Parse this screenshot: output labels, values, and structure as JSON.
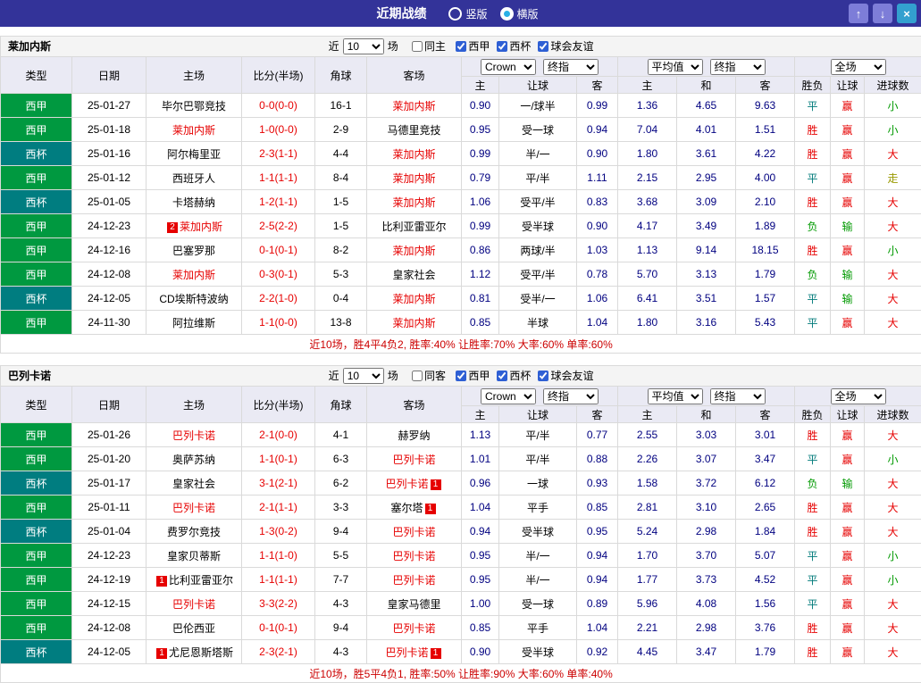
{
  "titlebar": {
    "title": "近期战绩",
    "radio_vertical": "竖版",
    "radio_horizontal": "横版",
    "selected": "横版"
  },
  "icons": {
    "up_arrow": "↑",
    "down_arrow": "↓",
    "close": "×"
  },
  "controls": {
    "near_label": "近",
    "count": "10",
    "games_label": "场",
    "leagues": [
      {
        "label": "西甲",
        "checked": true
      },
      {
        "label": "西杯",
        "checked": true
      },
      {
        "label": "球会友谊",
        "checked": true
      }
    ],
    "dd_group1": [
      "Crown",
      "终指"
    ],
    "dd_group2": [
      "平均值",
      "终指"
    ],
    "dd_group3": [
      "全场"
    ],
    "league_colors": {
      "西甲": "#009940",
      "西杯": "#007d80"
    },
    "result_colors": {
      "胜": "#e60000",
      "赢": "#e60000",
      "大": "#e60000",
      "平": "#007a7a",
      "负": "#009900",
      "输": "#009900",
      "小": "#009900",
      "走": "#999900"
    }
  },
  "columns": {
    "type": "类型",
    "date": "日期",
    "home": "主场",
    "score": "比分(半场)",
    "corner": "角球",
    "away": "客场",
    "ah": [
      "主",
      "让球",
      "客"
    ],
    "eu": [
      "主",
      "和",
      "客"
    ],
    "results": [
      "胜负",
      "让球",
      "进球数"
    ]
  },
  "sections": [
    {
      "team": "莱加内斯",
      "same_label": "同主",
      "rows": [
        {
          "lg": "西甲",
          "date": "25-01-27",
          "h": "毕尔巴鄂竞技",
          "a": "莱加内斯",
          "af": true,
          "score": "0-0(0-0)",
          "cor": "16-1",
          "o1": [
            "0.90",
            "一/球半",
            "0.99"
          ],
          "o2": [
            "1.36",
            "4.65",
            "9.63"
          ],
          "res": [
            "平",
            "赢",
            "小"
          ]
        },
        {
          "lg": "西甲",
          "date": "25-01-18",
          "h": "莱加内斯",
          "hf": true,
          "a": "马德里竞技",
          "score": "1-0(0-0)",
          "cor": "2-9",
          "o1": [
            "0.95",
            "受一球",
            "0.94"
          ],
          "o2": [
            "7.04",
            "4.01",
            "1.51"
          ],
          "res": [
            "胜",
            "赢",
            "小"
          ]
        },
        {
          "lg": "西杯",
          "date": "25-01-16",
          "h": "阿尔梅里亚",
          "a": "莱加内斯",
          "af": true,
          "score": "2-3(1-1)",
          "cor": "4-4",
          "o1": [
            "0.99",
            "半/一",
            "0.90"
          ],
          "o2": [
            "1.80",
            "3.61",
            "4.22"
          ],
          "res": [
            "胜",
            "赢",
            "大"
          ]
        },
        {
          "lg": "西甲",
          "date": "25-01-12",
          "h": "西班牙人",
          "a": "莱加内斯",
          "af": true,
          "score": "1-1(1-1)",
          "cor": "8-4",
          "o1": [
            "0.79",
            "平/半",
            "1.11"
          ],
          "o2": [
            "2.15",
            "2.95",
            "4.00"
          ],
          "res": [
            "平",
            "赢",
            "走"
          ]
        },
        {
          "lg": "西杯",
          "date": "25-01-05",
          "h": "卡塔赫纳",
          "a": "莱加内斯",
          "af": true,
          "score": "1-2(1-1)",
          "cor": "1-5",
          "o1": [
            "1.06",
            "受平/半",
            "0.83"
          ],
          "o2": [
            "3.68",
            "3.09",
            "2.10"
          ],
          "res": [
            "胜",
            "赢",
            "大"
          ]
        },
        {
          "lg": "西甲",
          "date": "24-12-23",
          "h": "莱加内斯",
          "hf": true,
          "hb_pre": "2",
          "a": "比利亚雷亚尔",
          "score": "2-5(2-2)",
          "cor": "1-5",
          "o1": [
            "0.99",
            "受半球",
            "0.90"
          ],
          "o2": [
            "4.17",
            "3.49",
            "1.89"
          ],
          "res": [
            "负",
            "输",
            "大"
          ]
        },
        {
          "lg": "西甲",
          "date": "24-12-16",
          "h": "巴塞罗那",
          "a": "莱加内斯",
          "af": true,
          "score": "0-1(0-1)",
          "cor": "8-2",
          "o1": [
            "0.86",
            "两球/半",
            "1.03"
          ],
          "o2": [
            "1.13",
            "9.14",
            "18.15"
          ],
          "res": [
            "胜",
            "赢",
            "小"
          ]
        },
        {
          "lg": "西甲",
          "date": "24-12-08",
          "h": "莱加内斯",
          "hf": true,
          "a": "皇家社会",
          "score": "0-3(0-1)",
          "cor": "5-3",
          "o1": [
            "1.12",
            "受平/半",
            "0.78"
          ],
          "o2": [
            "5.70",
            "3.13",
            "1.79"
          ],
          "res": [
            "负",
            "输",
            "大"
          ]
        },
        {
          "lg": "西杯",
          "date": "24-12-05",
          "h": "CD埃斯特波纳",
          "a": "莱加内斯",
          "af": true,
          "score": "2-2(1-0)",
          "cor": "0-4",
          "o1": [
            "0.81",
            "受半/一",
            "1.06"
          ],
          "o2": [
            "6.41",
            "3.51",
            "1.57"
          ],
          "res": [
            "平",
            "输",
            "大"
          ]
        },
        {
          "lg": "西甲",
          "date": "24-11-30",
          "h": "阿拉维斯",
          "a": "莱加内斯",
          "af": true,
          "score": "1-1(0-0)",
          "cor": "13-8",
          "o1": [
            "0.85",
            "半球",
            "1.04"
          ],
          "o2": [
            "1.80",
            "3.16",
            "5.43"
          ],
          "res": [
            "平",
            "赢",
            "大"
          ]
        }
      ],
      "summary": "近10场，胜4平4负2, 胜率:40% 让胜率:70% 大率:60% 单率:60%"
    },
    {
      "team": "巴列卡诺",
      "same_label": "同客",
      "rows": [
        {
          "lg": "西甲",
          "date": "25-01-26",
          "h": "巴列卡诺",
          "hf": true,
          "a": "赫罗纳",
          "score": "2-1(0-0)",
          "cor": "4-1",
          "o1": [
            "1.13",
            "平/半",
            "0.77"
          ],
          "o2": [
            "2.55",
            "3.03",
            "3.01"
          ],
          "res": [
            "胜",
            "赢",
            "大"
          ]
        },
        {
          "lg": "西甲",
          "date": "25-01-20",
          "h": "奥萨苏纳",
          "a": "巴列卡诺",
          "af": true,
          "score": "1-1(0-1)",
          "cor": "6-3",
          "o1": [
            "1.01",
            "平/半",
            "0.88"
          ],
          "o2": [
            "2.26",
            "3.07",
            "3.47"
          ],
          "res": [
            "平",
            "赢",
            "小"
          ]
        },
        {
          "lg": "西杯",
          "date": "25-01-17",
          "h": "皇家社会",
          "a": "巴列卡诺",
          "af": true,
          "ab_post": "1",
          "score": "3-1(2-1)",
          "cor": "6-2",
          "o1": [
            "0.96",
            "一球",
            "0.93"
          ],
          "o2": [
            "1.58",
            "3.72",
            "6.12"
          ],
          "res": [
            "负",
            "输",
            "大"
          ]
        },
        {
          "lg": "西甲",
          "date": "25-01-11",
          "h": "巴列卡诺",
          "hf": true,
          "a": "塞尔塔",
          "ab_post": "1",
          "score": "2-1(1-1)",
          "cor": "3-3",
          "o1": [
            "1.04",
            "平手",
            "0.85"
          ],
          "o2": [
            "2.81",
            "3.10",
            "2.65"
          ],
          "res": [
            "胜",
            "赢",
            "大"
          ]
        },
        {
          "lg": "西杯",
          "date": "25-01-04",
          "h": "费罗尔竞技",
          "a": "巴列卡诺",
          "af": true,
          "score": "1-3(0-2)",
          "cor": "9-4",
          "o1": [
            "0.94",
            "受半球",
            "0.95"
          ],
          "o2": [
            "5.24",
            "2.98",
            "1.84"
          ],
          "res": [
            "胜",
            "赢",
            "大"
          ]
        },
        {
          "lg": "西甲",
          "date": "24-12-23",
          "h": "皇家贝蒂斯",
          "a": "巴列卡诺",
          "af": true,
          "score": "1-1(1-0)",
          "cor": "5-5",
          "o1": [
            "0.95",
            "半/一",
            "0.94"
          ],
          "o2": [
            "1.70",
            "3.70",
            "5.07"
          ],
          "res": [
            "平",
            "赢",
            "小"
          ]
        },
        {
          "lg": "西甲",
          "date": "24-12-19",
          "h": "比利亚雷亚尔",
          "hb_pre": "1",
          "a": "巴列卡诺",
          "af": true,
          "score": "1-1(1-1)",
          "cor": "7-7",
          "o1": [
            "0.95",
            "半/一",
            "0.94"
          ],
          "o2": [
            "1.77",
            "3.73",
            "4.52"
          ],
          "res": [
            "平",
            "赢",
            "小"
          ]
        },
        {
          "lg": "西甲",
          "date": "24-12-15",
          "h": "巴列卡诺",
          "hf": true,
          "a": "皇家马德里",
          "score": "3-3(2-2)",
          "cor": "4-3",
          "o1": [
            "1.00",
            "受一球",
            "0.89"
          ],
          "o2": [
            "5.96",
            "4.08",
            "1.56"
          ],
          "res": [
            "平",
            "赢",
            "大"
          ]
        },
        {
          "lg": "西甲",
          "date": "24-12-08",
          "h": "巴伦西亚",
          "a": "巴列卡诺",
          "af": true,
          "score": "0-1(0-1)",
          "cor": "9-4",
          "o1": [
            "0.85",
            "平手",
            "1.04"
          ],
          "o2": [
            "2.21",
            "2.98",
            "3.76"
          ],
          "res": [
            "胜",
            "赢",
            "大"
          ]
        },
        {
          "lg": "西杯",
          "date": "24-12-05",
          "h": "尤尼恩斯塔斯",
          "hb_pre": "1",
          "a": "巴列卡诺",
          "af": true,
          "ab_post": "1",
          "score": "2-3(2-1)",
          "cor": "4-3",
          "o1": [
            "0.90",
            "受半球",
            "0.92"
          ],
          "o2": [
            "4.45",
            "3.47",
            "1.79"
          ],
          "res": [
            "胜",
            "赢",
            "大"
          ]
        }
      ],
      "summary": "近10场，胜5平4负1, 胜率:50% 让胜率:90% 大率:60% 单率:40%"
    }
  ]
}
